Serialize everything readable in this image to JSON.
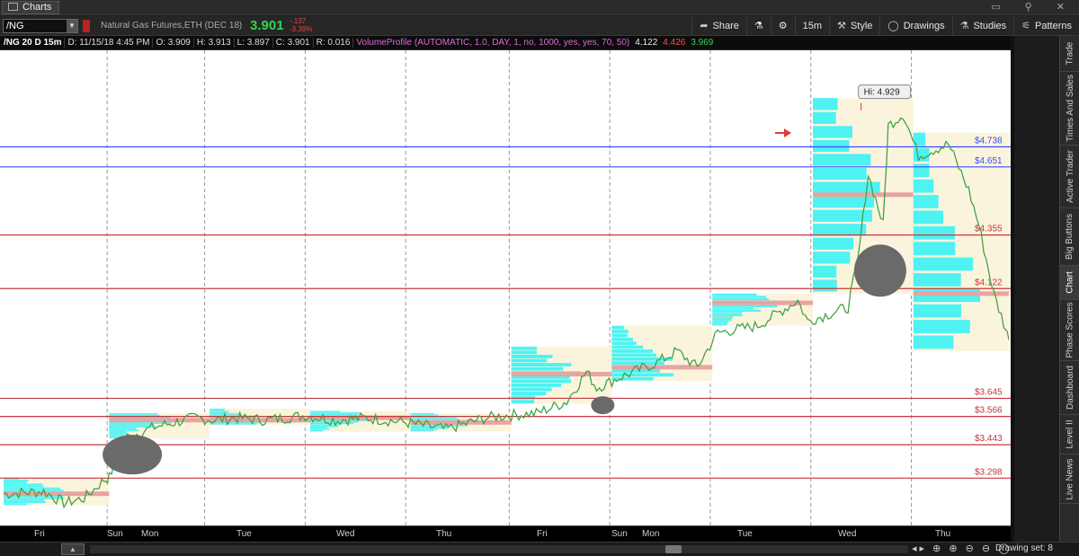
{
  "window": {
    "tab_label": "Charts",
    "win_buttons": "▭ ⚲ ✕"
  },
  "toolbar": {
    "symbol": "/NG",
    "instrument": "Natural Gas Futures,ETH (DEC 18)",
    "last": "3.901",
    "change": "-.137",
    "change_pct": "-3.39%",
    "share": "Share",
    "flask": "⚗",
    "settings": "⚙",
    "timeframe": "15m",
    "style": "Style",
    "drawings": "Drawings",
    "studies": "Studies",
    "patterns": "Patterns"
  },
  "infobar": {
    "symbol": "/NG 20 D 15m",
    "date": "D: 11/15/18 4:45 PM",
    "open": "O: 3.909",
    "high": "H: 3.913",
    "low": "L: 3.897",
    "close": "C: 3.901",
    "range": "R: 0.016",
    "study": "VolumeProfile (AUTOMATIC, 1.0, DAY, 1, no, 1000, yes, yes, 70, 50)",
    "v1": "4.122",
    "v2": "4.426",
    "v3": "3.969"
  },
  "chart_data": {
    "type": "candlestick",
    "y_ticks": [
      "5.1",
      "5",
      "4.9",
      "4.8",
      "4.7",
      "4.6",
      "4.5",
      "4.4",
      "4.3",
      "4.2",
      "4.1",
      "4",
      "3.9",
      "3.8",
      "3.7",
      "3.6",
      "3.5",
      "3.4",
      "3.3",
      "3.2",
      "3.1"
    ],
    "ylim": [
      3.1,
      5.15
    ],
    "x_labels": [
      "Fri",
      "Sun",
      "Mon",
      "Tue",
      "Wed",
      "Thu",
      "Fri",
      "Sun",
      "Mon",
      "Tue",
      "Wed",
      "Thu"
    ],
    "high_annotation": "Hi: 4.929",
    "horizontal_lines": [
      {
        "price": 4.738,
        "label": "$4.738",
        "color": "#3b4cff"
      },
      {
        "price": 4.651,
        "label": "$4.651",
        "color": "#3b4cff"
      },
      {
        "price": 4.355,
        "label": "$4.355",
        "color": "#c4363c"
      },
      {
        "price": 4.122,
        "label": "$4.122",
        "color": "#c4363c"
      },
      {
        "price": 3.645,
        "label": "$3.645",
        "color": "#c4363c"
      },
      {
        "price": 3.566,
        "label": "$3.566",
        "color": "#c4363c"
      },
      {
        "price": 3.443,
        "label": "$3.443",
        "color": "#c4363c"
      },
      {
        "price": 3.298,
        "label": "$3.298",
        "color": "#c4363c"
      }
    ],
    "price_bubbles": [
      {
        "price": 4.426,
        "label": "4.426",
        "color": "#d42a2a"
      },
      {
        "price": 4.122,
        "label": "4.122",
        "color": "#d84fd0"
      },
      {
        "price": 3.969,
        "label": "3.969",
        "color": "#2cb547"
      },
      {
        "price": 3.901,
        "label": "3.901",
        "color": "#d42a2a"
      }
    ],
    "price_path": [
      [
        0,
        3.23
      ],
      [
        0.04,
        3.24
      ],
      [
        0.06,
        3.19
      ],
      [
        0.08,
        3.21
      ],
      [
        0.1,
        3.29
      ],
      [
        0.105,
        3.3
      ],
      [
        0.12,
        3.47
      ],
      [
        0.15,
        3.52
      ],
      [
        0.19,
        3.56
      ],
      [
        0.21,
        3.55
      ],
      [
        0.23,
        3.56
      ],
      [
        0.26,
        3.55
      ],
      [
        0.3,
        3.57
      ],
      [
        0.33,
        3.55
      ],
      [
        0.36,
        3.56
      ],
      [
        0.4,
        3.54
      ],
      [
        0.44,
        3.51
      ],
      [
        0.48,
        3.56
      ],
      [
        0.5,
        3.57
      ],
      [
        0.53,
        3.58
      ],
      [
        0.56,
        3.63
      ],
      [
        0.58,
        3.76
      ],
      [
        0.59,
        3.69
      ],
      [
        0.61,
        3.73
      ],
      [
        0.65,
        3.8
      ],
      [
        0.67,
        3.85
      ],
      [
        0.69,
        3.78
      ],
      [
        0.71,
        3.93
      ],
      [
        0.75,
        3.96
      ],
      [
        0.79,
        4.07
      ],
      [
        0.8,
        3.98
      ],
      [
        0.84,
        4.04
      ],
      [
        0.85,
        4.25
      ],
      [
        0.86,
        4.62
      ],
      [
        0.875,
        4.4
      ],
      [
        0.88,
        4.83
      ],
      [
        0.895,
        4.88
      ],
      [
        0.91,
        4.7
      ],
      [
        0.94,
        4.75
      ],
      [
        0.96,
        4.55
      ],
      [
        0.97,
        4.4
      ],
      [
        0.985,
        4.1
      ],
      [
        0.995,
        3.97
      ],
      [
        1.0,
        3.9
      ]
    ],
    "volume_profiles": [
      {
        "x0": 0.0,
        "x1": 0.105,
        "poc": 3.23,
        "lo": 3.18,
        "hi": 3.3
      },
      {
        "x0": 0.105,
        "x1": 0.205,
        "poc": 3.55,
        "lo": 3.47,
        "hi": 3.58
      },
      {
        "x0": 0.205,
        "x1": 0.305,
        "poc": 3.55,
        "lo": 3.53,
        "hi": 3.6
      },
      {
        "x0": 0.305,
        "x1": 0.405,
        "poc": 3.56,
        "lo": 3.5,
        "hi": 3.59
      },
      {
        "x0": 0.405,
        "x1": 0.505,
        "poc": 3.54,
        "lo": 3.5,
        "hi": 3.58
      },
      {
        "x0": 0.505,
        "x1": 0.605,
        "poc": 3.75,
        "lo": 3.62,
        "hi": 3.87
      },
      {
        "x0": 0.605,
        "x1": 0.705,
        "poc": 3.78,
        "lo": 3.72,
        "hi": 3.96
      },
      {
        "x0": 0.705,
        "x1": 0.805,
        "poc": 4.06,
        "lo": 3.96,
        "hi": 4.1
      },
      {
        "x0": 0.805,
        "x1": 0.905,
        "poc": 4.53,
        "lo": 4.1,
        "hi": 4.95
      },
      {
        "x0": 0.905,
        "x1": 1.0,
        "poc": 4.1,
        "lo": 3.85,
        "hi": 4.8
      }
    ]
  },
  "time_axis": {
    "labels": [
      {
        "t": "Fri",
        "x": 0.03
      },
      {
        "t": "Sun",
        "x": 0.103
      },
      {
        "t": "Mon",
        "x": 0.137
      },
      {
        "t": "Tue",
        "x": 0.232
      },
      {
        "t": "Wed",
        "x": 0.331
      },
      {
        "t": "Thu",
        "x": 0.43
      },
      {
        "t": "Fri",
        "x": 0.53
      },
      {
        "t": "Sun",
        "x": 0.605
      },
      {
        "t": "Mon",
        "x": 0.635
      },
      {
        "t": "Tue",
        "x": 0.73
      },
      {
        "t": "Wed",
        "x": 0.83
      },
      {
        "t": "Thu",
        "x": 0.927
      }
    ]
  },
  "bottom": {
    "drawing_set": "Drawing set: 8",
    "icons": "◂▸ ⊕ ⊕ ⊖ ⊖ ◯"
  },
  "sidebar": {
    "tabs": [
      "Trade",
      "Times And Sales",
      "Active Trader",
      "Big Buttons",
      "Chart",
      "Phase Scores",
      "Dashboard",
      "Level II",
      "Live News"
    ]
  }
}
